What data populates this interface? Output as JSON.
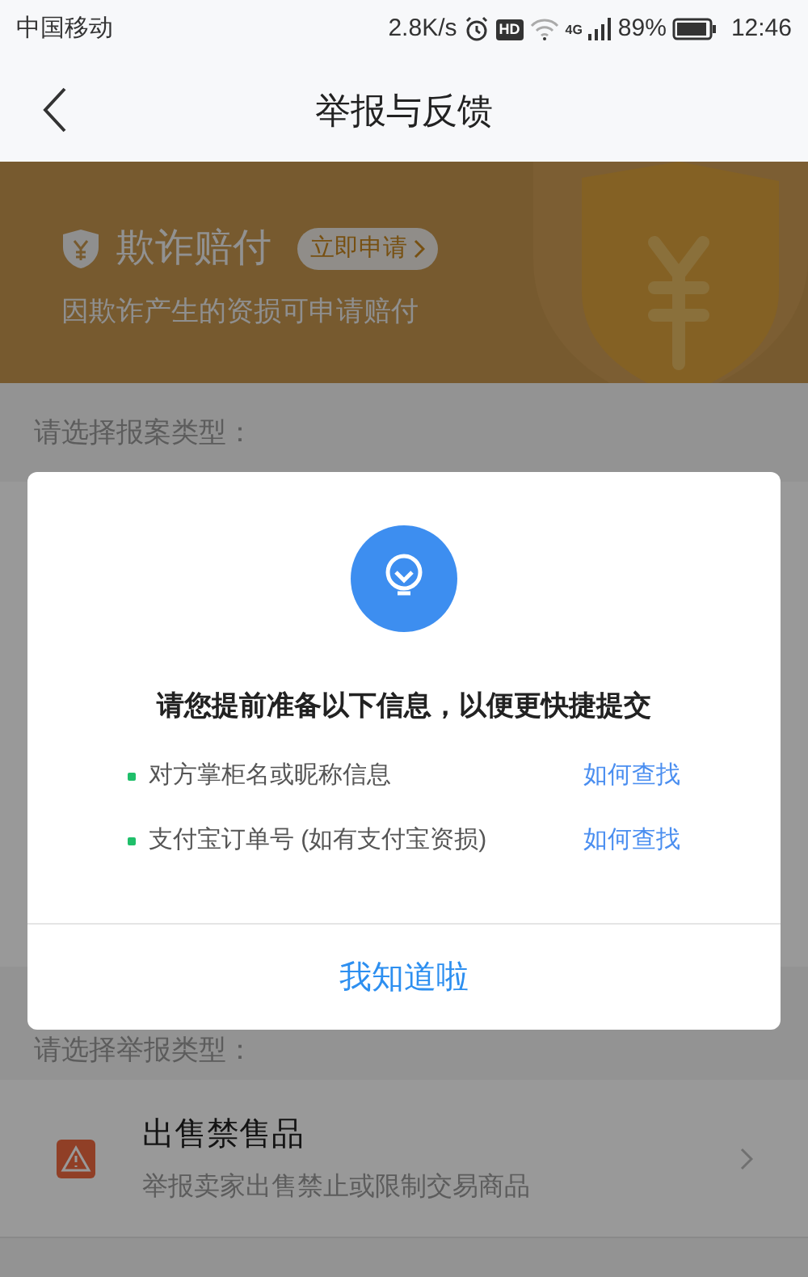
{
  "status_bar": {
    "carrier": "中国移动",
    "speed": "2.8K/s",
    "hd": "HD",
    "network": "4G",
    "battery": "89%",
    "time": "12:46"
  },
  "nav": {
    "title": "举报与反馈"
  },
  "banner": {
    "title": "欺诈赔付",
    "action": "立即申请",
    "subtitle": "因欺诈产生的资损可申请赔付"
  },
  "section_label": "请选择报案类型：",
  "section2_label": "请选择举报类型：",
  "items": [
    {
      "title": "出售禁售品",
      "description": "举报卖家出售禁止或限制交易商品"
    }
  ],
  "dialog": {
    "title": "请您提前准备以下信息，以便更快捷提交",
    "rows": [
      {
        "text": "对方掌柜名或昵称信息",
        "link": "如何查找"
      },
      {
        "text": "支付宝订单号 (如有支付宝资损)",
        "link": "如何查找"
      }
    ],
    "button": "我知道啦"
  }
}
